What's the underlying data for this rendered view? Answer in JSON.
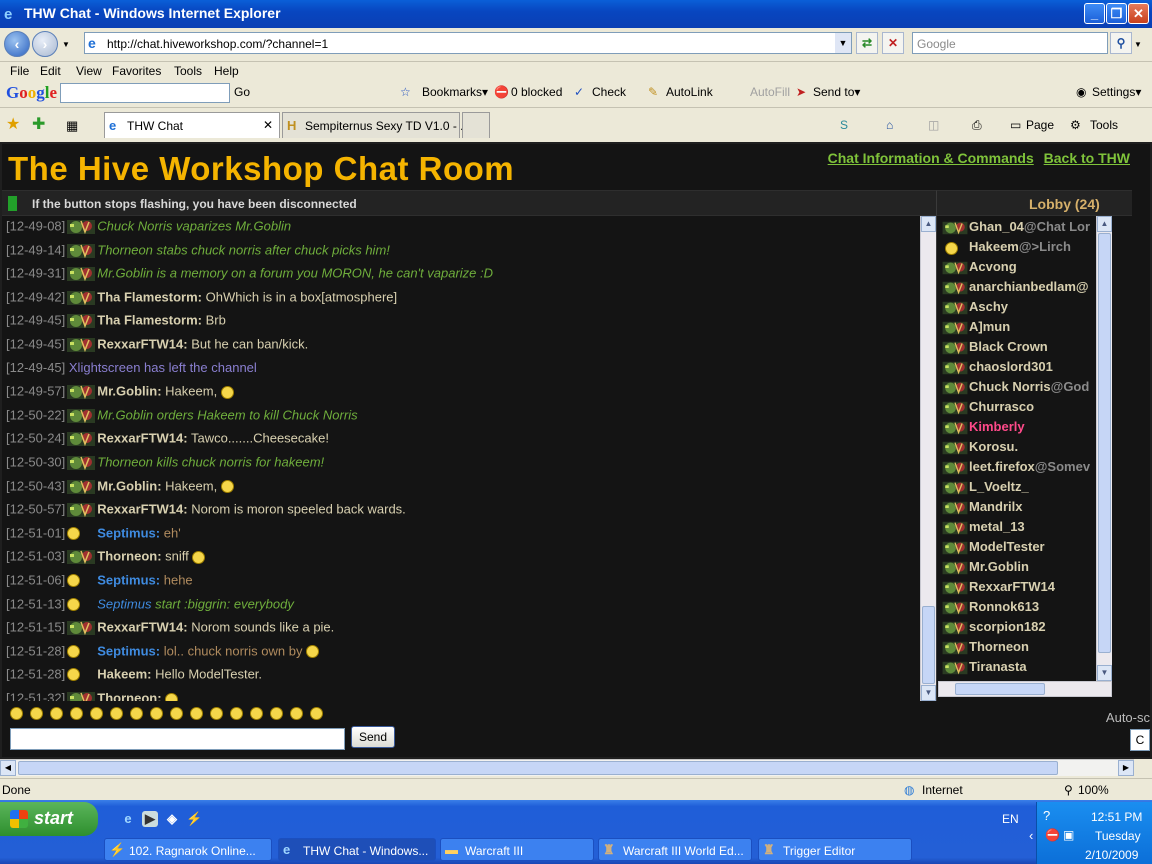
{
  "window": {
    "title": "THW Chat - Windows Internet Explorer",
    "buttons": [
      "_",
      "❐",
      "✕"
    ]
  },
  "address_bar": {
    "url": "http://chat.hiveworkshop.com/?channel=1",
    "search_placeholder": "Google"
  },
  "menu": [
    "File",
    "Edit",
    "View",
    "Favorites",
    "Tools",
    "Help"
  ],
  "google_toolbar": {
    "logo": "Google",
    "go": "Go",
    "items": [
      "Bookmarks▾",
      "0 blocked",
      "Check",
      "AutoLink",
      "AutoFill",
      "Send to▾"
    ],
    "settings": "Settings▾"
  },
  "tabs": [
    {
      "label": "THW Chat",
      "active": true
    },
    {
      "label": "Sempiternus Sexy TD V1.0 - ...",
      "active": false
    }
  ],
  "commands": [
    "Page",
    "Tools"
  ],
  "page": {
    "title": "The Hive Workshop Chat Room",
    "links": [
      "Chat Information & Commands",
      "Back to THW"
    ],
    "status_message": "If the button stops flashing, you have been disconnected",
    "lobby_title": "Lobby (24)",
    "send_label": "Send",
    "auto_scroll": "Auto-sc",
    "auto_btn": "C"
  },
  "chat": [
    {
      "time": "[12-49-08]",
      "avatar": true,
      "nick": "",
      "text": "Chuck Norris vaparizes Mr.Goblin",
      "style": "emote"
    },
    {
      "time": "[12-49-14]",
      "avatar": true,
      "nick": "",
      "text": "Thorneon stabs chuck norris after chuck picks him!",
      "style": "emote"
    },
    {
      "time": "[12-49-31]",
      "avatar": true,
      "nick": "",
      "text": "Mr.Goblin is a memory on a forum you MORON, he can't vaparize :D",
      "style": "emote"
    },
    {
      "time": "[12-49-42]",
      "avatar": true,
      "nick": "Tha Flamestorm:",
      "text": "OhWhich is in a box[atmosphere]",
      "style": "normal"
    },
    {
      "time": "[12-49-45]",
      "avatar": true,
      "nick": "Tha Flamestorm:",
      "text": "Brb",
      "style": "normal"
    },
    {
      "time": "[12-49-45]",
      "avatar": true,
      "nick": "RexxarFTW14:",
      "text": "But he can ban/kick.",
      "style": "normal"
    },
    {
      "time": "[12-49-45]",
      "avatar": false,
      "nick": "",
      "text": "Xlightscreen has left the channel",
      "style": "system"
    },
    {
      "time": "[12-49-57]",
      "avatar": true,
      "nick": "Mr.Goblin:",
      "text": "Hakeem,",
      "style": "normal",
      "smile": true
    },
    {
      "time": "[12-50-22]",
      "avatar": true,
      "nick": "",
      "text": "Mr.Goblin orders Hakeem to kill Chuck Norris",
      "style": "emote"
    },
    {
      "time": "[12-50-24]",
      "avatar": true,
      "nick": "RexxarFTW14:",
      "text": "Tawco.......Cheesecake!",
      "style": "normal"
    },
    {
      "time": "[12-50-30]",
      "avatar": true,
      "nick": "",
      "text": "Thorneon kills chuck norris for hakeem!",
      "style": "emote"
    },
    {
      "time": "[12-50-43]",
      "avatar": true,
      "nick": "Mr.Goblin:",
      "text": "Hakeem,",
      "style": "normal",
      "smile": true
    },
    {
      "time": "[12-50-57]",
      "avatar": true,
      "nick": "RexxarFTW14:",
      "text": "Norom is moron speeled back wards.",
      "style": "normal"
    },
    {
      "time": "[12-51-01]",
      "avatar": false,
      "smile_avatar": true,
      "nick": "Septimus:",
      "text": "eh'",
      "style": "blue"
    },
    {
      "time": "[12-51-03]",
      "avatar": true,
      "nick": "Thorneon:",
      "text": "sniff",
      "style": "normal",
      "smile": true
    },
    {
      "time": "[12-51-06]",
      "avatar": false,
      "smile_avatar": true,
      "nick": "Septimus:",
      "text": "hehe",
      "style": "blue"
    },
    {
      "time": "[12-51-13]",
      "avatar": false,
      "smile_avatar": true,
      "nick": "Septimus",
      "text": "start :biggrin: everybody",
      "style": "blue-emote"
    },
    {
      "time": "[12-51-15]",
      "avatar": true,
      "nick": "RexxarFTW14:",
      "text": "Norom sounds like a pie.",
      "style": "normal"
    },
    {
      "time": "[12-51-28]",
      "avatar": false,
      "smile_avatar": true,
      "nick": "Septimus:",
      "text": "lol.. chuck norris own by",
      "style": "blue",
      "smile": true
    },
    {
      "time": "[12-51-28]",
      "avatar": false,
      "smile_avatar": true,
      "nick": "Hakeem:",
      "text": "Hello ModelTester.",
      "style": "normal"
    },
    {
      "time": "[12-51-32]",
      "avatar": true,
      "nick": "Thorneon:",
      "text": "",
      "style": "normal",
      "smile": true
    }
  ],
  "lobby": [
    {
      "name": "Ghan_04",
      "tag": "@Chat Lor",
      "color": "normal"
    },
    {
      "name": "Hakeem",
      "tag": "@>Lirch",
      "color": "normal",
      "smiley": true
    },
    {
      "name": "Acvong",
      "tag": "",
      "color": "normal"
    },
    {
      "name": "anarchianbedlam@",
      "tag": "",
      "color": "normal"
    },
    {
      "name": "Aschy",
      "tag": "",
      "color": "normal"
    },
    {
      "name": "A]mun",
      "tag": "",
      "color": "normal"
    },
    {
      "name": "Black Crown",
      "tag": "",
      "color": "normal"
    },
    {
      "name": "chaoslord301",
      "tag": "",
      "color": "normal"
    },
    {
      "name": "Chuck Norris",
      "tag": "@God",
      "color": "normal"
    },
    {
      "name": "Churrasco",
      "tag": "",
      "color": "normal"
    },
    {
      "name": "Kimberly",
      "tag": "",
      "color": "pink"
    },
    {
      "name": "Korosu.",
      "tag": "",
      "color": "normal"
    },
    {
      "name": "leet.firefox",
      "tag": "@Somev",
      "color": "normal"
    },
    {
      "name": "L_Voeltz_",
      "tag": "",
      "color": "normal"
    },
    {
      "name": "Mandrilx",
      "tag": "",
      "color": "normal"
    },
    {
      "name": "metal_13",
      "tag": "",
      "color": "normal"
    },
    {
      "name": "ModelTester",
      "tag": "",
      "color": "normal"
    },
    {
      "name": "Mr.Goblin",
      "tag": "",
      "color": "normal"
    },
    {
      "name": "RexxarFTW14",
      "tag": "",
      "color": "normal"
    },
    {
      "name": "Ronnok613",
      "tag": "",
      "color": "normal"
    },
    {
      "name": "scorpion182",
      "tag": "",
      "color": "normal"
    },
    {
      "name": "Thorneon",
      "tag": "",
      "color": "normal"
    },
    {
      "name": "Tiranasta",
      "tag": "",
      "color": "normal"
    }
  ],
  "statusbar": {
    "left": "Done",
    "zone": "Internet",
    "zoom": "100%"
  },
  "taskbar": {
    "start": "start",
    "buttons": [
      {
        "label": "102. Ragnarok Online...",
        "active": false
      },
      {
        "label": "THW Chat - Windows...",
        "active": true
      },
      {
        "label": "Warcraft III",
        "active": false
      },
      {
        "label": "Warcraft III World Ed...",
        "active": false
      },
      {
        "label": "Trigger Editor",
        "active": false
      }
    ],
    "lang": "EN",
    "time": "12:51 PM",
    "day": "Tuesday",
    "date": "2/10/2009"
  },
  "colors": {
    "title_gold": "#f5b400",
    "link_green": "#7fc33a",
    "emote_green": "#6fae3c",
    "nick_blue": "#3f8be0",
    "kimberly_pink": "#ff4a8a"
  }
}
